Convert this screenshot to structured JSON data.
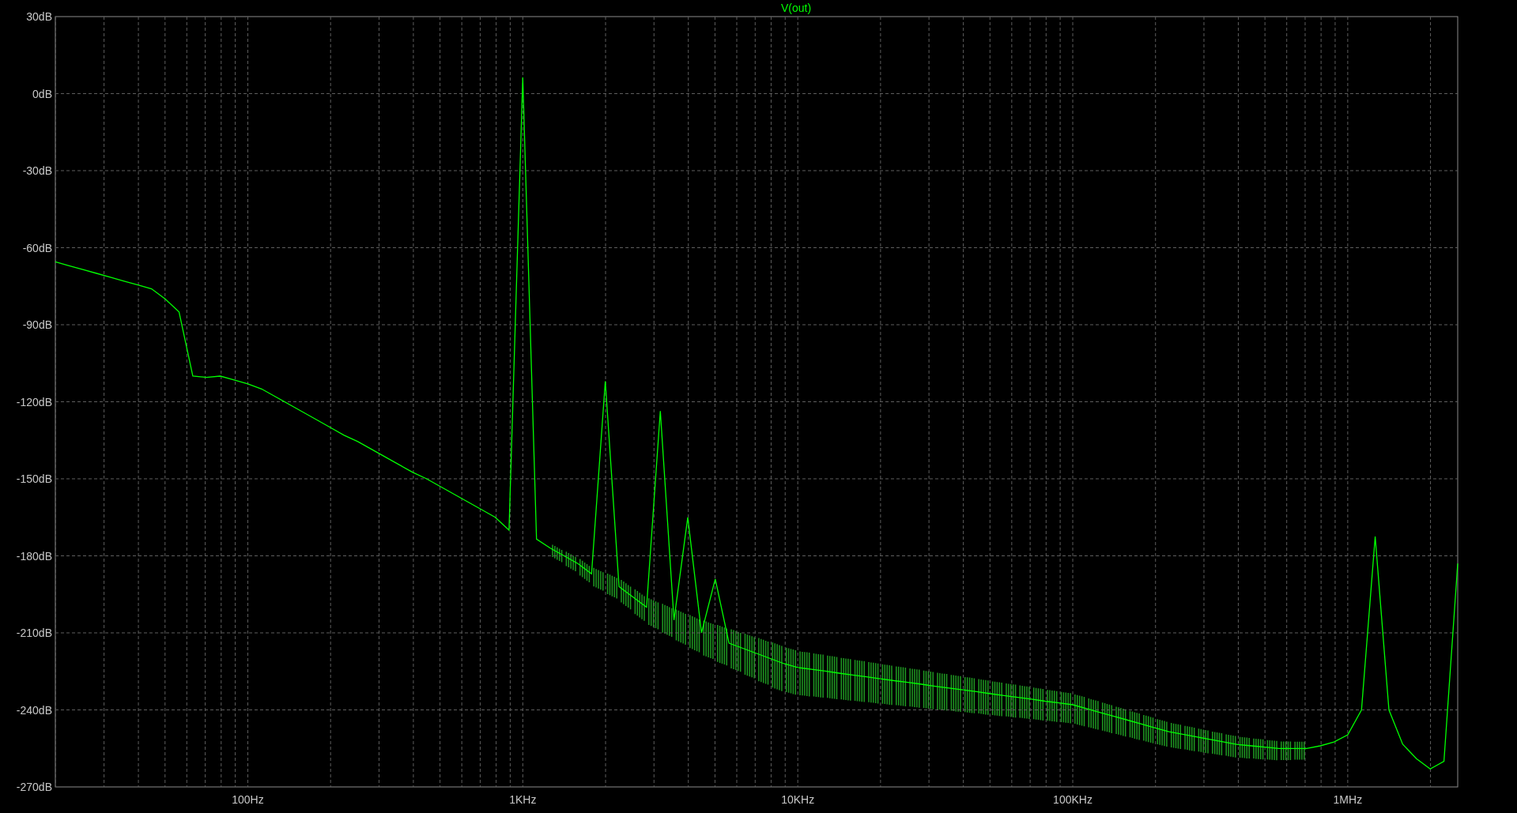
{
  "plot": {
    "chart_data": {
      "type": "line",
      "grid": true,
      "ylim": [
        -270,
        30
      ],
      "categories": [
        null,
        null,
        null,
        null,
        null,
        null,
        null,
        null,
        null,
        null,
        null,
        null,
        null,
        null,
        "100Hz",
        null,
        null,
        null,
        null,
        null,
        null,
        null,
        null,
        null,
        null,
        null,
        null,
        null,
        null,
        null,
        null,
        null,
        null,
        null,
        "1KHz",
        null,
        null,
        null,
        null,
        null,
        null,
        null,
        null,
        null,
        null,
        null,
        null,
        null,
        null,
        null,
        null,
        null,
        null,
        null,
        "10KHz",
        null,
        null,
        null,
        null,
        null,
        null,
        null,
        null,
        null,
        null,
        null,
        null,
        null,
        null,
        null,
        null,
        null,
        null,
        null,
        "100KHz",
        null,
        null,
        null,
        null,
        null,
        null,
        null,
        null,
        null,
        null,
        null,
        null,
        null,
        null,
        null,
        null,
        null,
        null,
        null,
        "1MHz",
        null,
        null,
        null,
        null,
        null,
        null,
        null,
        null
      ],
      "yticks": [
        {
          "value": 30,
          "label": "30dB"
        },
        {
          "value": 0,
          "label": "0dB"
        },
        {
          "value": -30,
          "label": "-30dB"
        },
        {
          "value": -60,
          "label": "-60dB"
        },
        {
          "value": -90,
          "label": "-90dB"
        },
        {
          "value": -120,
          "label": "-120dB"
        },
        {
          "value": -150,
          "label": "-150dB"
        },
        {
          "value": -180,
          "label": "-180dB"
        },
        {
          "value": -210,
          "label": "-210dB"
        },
        {
          "value": -240,
          "label": "-240dB"
        },
        {
          "value": -270,
          "label": "-270dB"
        }
      ],
      "series": [
        {
          "name": "V(out)",
          "color": "#00ff00",
          "values": [
            -65.5,
            -67,
            -68.5,
            -70,
            -71.5,
            -73,
            -74.5,
            -76,
            -80,
            -85,
            -110,
            -110.5,
            -110,
            -111.5,
            -113,
            -115,
            -118,
            -121,
            -124,
            -127,
            -130,
            -133,
            -135.5,
            -138.5,
            -141.5,
            -144.5,
            -147.5,
            -150,
            -153,
            -156,
            -159,
            -162,
            -165,
            -170,
            6.3,
            -173.5,
            -177,
            -180,
            -183,
            -187,
            -112,
            -192,
            -196,
            -200,
            -123.6,
            -205,
            -165,
            -210,
            -189,
            -214,
            -216,
            -218,
            -220,
            -222,
            -223.5,
            -224.2,
            -224.9,
            -225.7,
            -226.4,
            -227.1,
            -227.9,
            -228.6,
            -229.3,
            -230,
            -230.8,
            -231.5,
            -232.2,
            -232.9,
            -233.7,
            -234.4,
            -235.1,
            -235.8,
            -236.6,
            -237.3,
            -238,
            -239.5,
            -241,
            -242.5,
            -244,
            -245.5,
            -247,
            -248.5,
            -249.5,
            -250.5,
            -251.5,
            -252.5,
            -253.5,
            -254,
            -254.5,
            -255,
            -255,
            -255,
            -254,
            -252.5,
            -249.7,
            -240,
            -172.5,
            -240,
            -253.4,
            -259,
            -263,
            -260,
            -183
          ]
        }
      ]
    }
  }
}
